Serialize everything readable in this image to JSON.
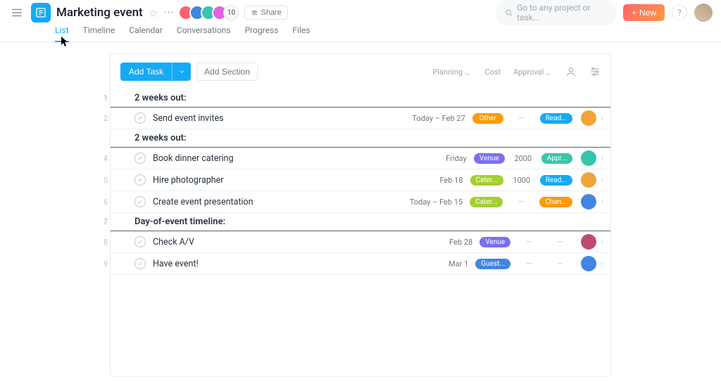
{
  "header": {
    "project_title": "Marketing event",
    "share_label": "Share",
    "member_count": "10",
    "avatar_colors": [
      "#fc636b",
      "#4186e0",
      "#37c5ab",
      "#e362e3"
    ]
  },
  "topright": {
    "search_placeholder": "Go to any project or task...",
    "new_label": "New",
    "help_label": "?"
  },
  "tabs": [
    "List",
    "Timeline",
    "Calendar",
    "Conversations",
    "Progress",
    "Files"
  ],
  "active_tab": "List",
  "toolbar": {
    "add_task_label": "Add Task",
    "add_section_label": "Add Section"
  },
  "columns": [
    "Planning ca...",
    "Cost",
    "Approval st..."
  ],
  "pill_colors": {
    "Other": "#fd9a00",
    "Venue": "#7a6ff0",
    "Cater...": "#a4cf30",
    "Guest...": "#4186e0",
    "Read...": "#14aaf5",
    "Appr...": "#37c5ab",
    "Chan...": "#fd9a00"
  },
  "sections": [
    {
      "num": "1",
      "title": "2 weeks out:",
      "tasks": [
        {
          "num": "2",
          "name": "Send event invites",
          "date": "Today – Feb 27",
          "cat": "Other",
          "cost": "",
          "approval": "Read...",
          "assignee": "#f2a33a"
        }
      ]
    },
    {
      "num": "",
      "title": "2 weeks out:",
      "tasks": [
        {
          "num": "4",
          "name": "Book dinner catering",
          "date": "Friday",
          "cat": "Venue",
          "cost": "2000",
          "approval": "Appr...",
          "assignee": "#37c5ab"
        },
        {
          "num": "5",
          "name": "Hire photographer",
          "date": "Feb 18",
          "cat": "Cater...",
          "cost": "1000",
          "approval": "Read...",
          "assignee": "#f2a33a"
        },
        {
          "num": "6",
          "name": "Create event presentation",
          "date": "Today – Feb 15",
          "cat": "Cater...",
          "cost": "",
          "approval": "Chan...",
          "assignee": "#4186e0"
        }
      ]
    },
    {
      "num": "7",
      "title": "Day-of-event timeline:",
      "tasks": [
        {
          "num": "8",
          "name": "Check A/V",
          "date": "Feb 28",
          "cat": "Venue",
          "cost": "",
          "approval": "",
          "assignee": "#c04b6d"
        },
        {
          "num": "9",
          "name": "Have event!",
          "date": "Mar 1",
          "cat": "Guest...",
          "cost": "",
          "approval": "",
          "assignee": "#4186e0"
        }
      ]
    }
  ]
}
